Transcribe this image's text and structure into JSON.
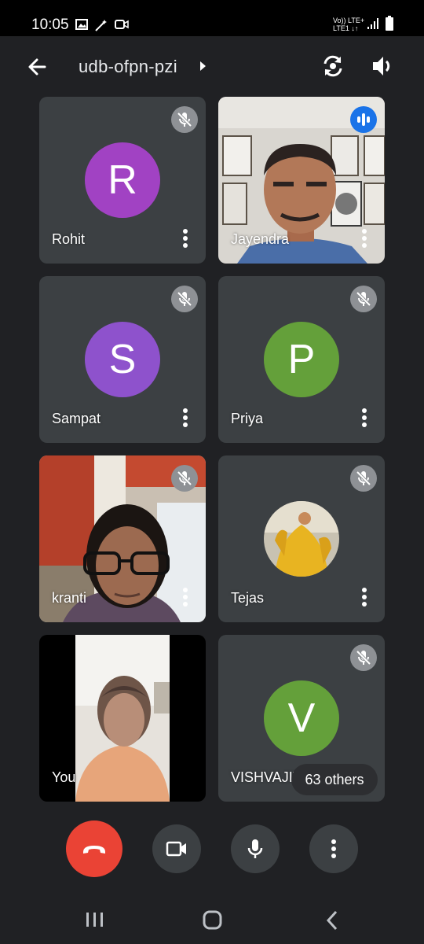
{
  "status_bar": {
    "time": "10:05",
    "left_icons": [
      "image-icon",
      "magic-wand-icon",
      "video-notification-icon"
    ],
    "network_line1": "Vo)) LTE+",
    "network_line2": "LTE1 ↓↑",
    "right_icons": [
      "signal-icon",
      "battery-icon"
    ]
  },
  "app_bar": {
    "title": "udb-ofpn-pzi",
    "icons": [
      "back-arrow-icon",
      "caret-right-icon",
      "switch-camera-icon",
      "speaker-icon"
    ]
  },
  "participants": [
    {
      "name": "Rohit",
      "initial": "R",
      "color": "#a142c3",
      "muted": true,
      "video": false
    },
    {
      "name": "Jayendra",
      "initial": "",
      "color": "",
      "muted": false,
      "speaking": true,
      "video": true
    },
    {
      "name": "Sampat",
      "initial": "S",
      "color": "#8e52cc",
      "muted": true,
      "video": false
    },
    {
      "name": "Priya",
      "initial": "P",
      "color": "#64a03a",
      "muted": true,
      "video": false
    },
    {
      "name": "kranti",
      "initial": "",
      "color": "",
      "muted": true,
      "video": true
    },
    {
      "name": "Tejas",
      "initial": "",
      "color": "",
      "muted": true,
      "video": false,
      "photo_avatar": true
    },
    {
      "name": "You",
      "initial": "",
      "color": "",
      "muted": false,
      "video": true
    },
    {
      "name": "VISHVAJIT",
      "initial": "V",
      "color": "#64a03a",
      "muted": true,
      "video": false
    }
  ],
  "others_chip": "63 others",
  "controls": {
    "end_call_icon": "phone-hangup-icon",
    "camera_icon": "video-camera-icon",
    "mic_icon": "microphone-icon",
    "more_icon": "more-vertical-icon",
    "end_color": "#ea4335"
  },
  "nav_bar": {
    "icons": [
      "recent-apps-icon",
      "home-icon",
      "back-nav-icon"
    ]
  }
}
